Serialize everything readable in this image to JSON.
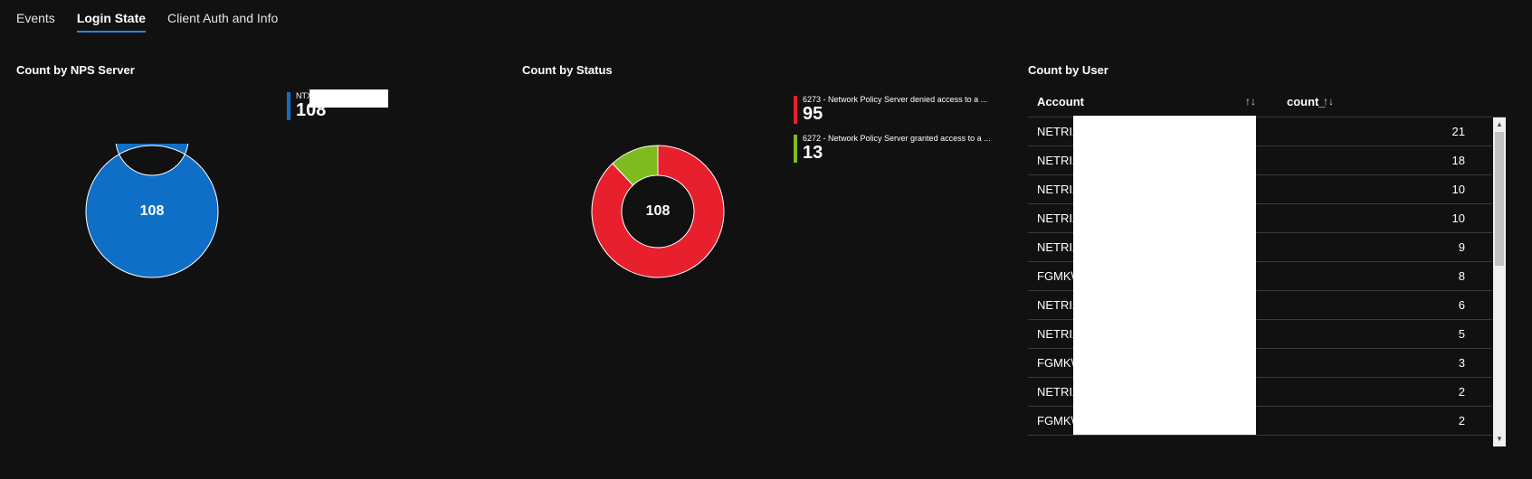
{
  "tabs": [
    {
      "label": "Events",
      "active": false
    },
    {
      "label": "Login State",
      "active": true
    },
    {
      "label": "Client Auth and Info",
      "active": false
    }
  ],
  "nps_server": {
    "title": "Count by NPS Server",
    "center_total": "108",
    "legend": [
      {
        "label": "NTX",
        "value": "108",
        "color": "#0f6fc6"
      }
    ],
    "chart_data": {
      "type": "pie",
      "categories": [
        "NTX"
      ],
      "values": [
        108
      ],
      "colors": [
        "#0f6fc6"
      ]
    }
  },
  "status": {
    "title": "Count by Status",
    "center_total": "108",
    "legend": [
      {
        "label": "6273 - Network Policy Server denied access to a ...",
        "value": "95",
        "color": "#e8202e"
      },
      {
        "label": "6272 - Network Policy Server granted access to a ...",
        "value": "13",
        "color": "#7dbb1f"
      }
    ],
    "chart_data": {
      "type": "pie",
      "categories": [
        "6273 - Network Policy Server denied access to a ...",
        "6272 - Network Policy Server granted access to a ..."
      ],
      "values": [
        95,
        13
      ],
      "colors": [
        "#e8202e",
        "#7dbb1f"
      ]
    }
  },
  "users": {
    "title": "Count by User",
    "columns": {
      "account": "Account",
      "count": "count_"
    },
    "sort_icon": "↑↓",
    "rows": [
      {
        "account": "NETRIX",
        "count": "21"
      },
      {
        "account": "NETRIX",
        "count": "18"
      },
      {
        "account": "NETRIX",
        "count": "10"
      },
      {
        "account": "NETRIX",
        "count": "10"
      },
      {
        "account": "NETRIX",
        "count": "9"
      },
      {
        "account": "FGMK\\",
        "count": "8"
      },
      {
        "account": "NETRIX",
        "count": "6"
      },
      {
        "account": "NETRIX",
        "count": "5"
      },
      {
        "account": "FGMK\\",
        "count": "3"
      },
      {
        "account": "NETRIX",
        "count": "2"
      },
      {
        "account": "FGMK\\",
        "count": "2"
      }
    ]
  }
}
